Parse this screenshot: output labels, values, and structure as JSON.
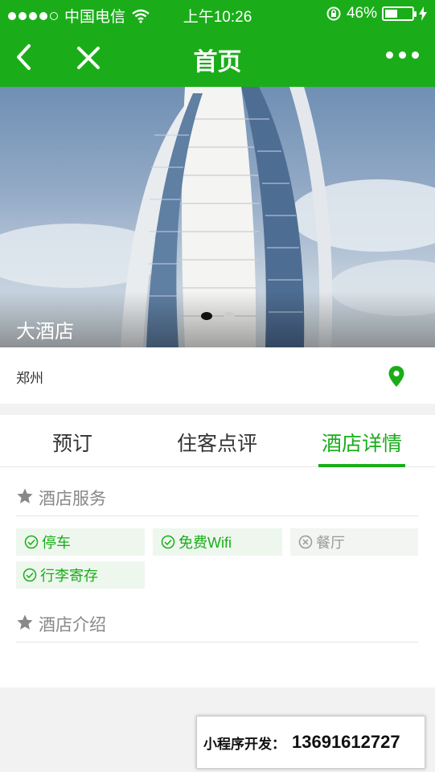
{
  "status_bar": {
    "carrier": "中国电信",
    "time": "上午10:26",
    "battery_percent": "46%",
    "battery_level": 0.46
  },
  "nav": {
    "title": "首页",
    "back_icon": "chevron-left-icon",
    "close_icon": "close-icon",
    "more_icon": "more-icon"
  },
  "banner": {
    "title": "大酒店",
    "slide_count": 2,
    "active_slide": 1
  },
  "location": {
    "city": "郑州",
    "icon": "location-pin-icon"
  },
  "tabs": [
    {
      "label": "预订",
      "active": false
    },
    {
      "label": "住客点评",
      "active": false
    },
    {
      "label": "酒店详情",
      "active": true
    }
  ],
  "services_section": {
    "title": "酒店服务",
    "items": [
      {
        "label": "停车",
        "available": true
      },
      {
        "label": "免费Wifi",
        "available": true
      },
      {
        "label": "餐厅",
        "available": false
      },
      {
        "label": "行李寄存",
        "available": true
      }
    ]
  },
  "intro_section": {
    "title": "酒店介绍"
  },
  "contact_banner": {
    "label": "小程序开发：",
    "phone": "13691612727"
  },
  "colors": {
    "brand_green": "#1aad19",
    "chip_bg": "#eef7ee"
  }
}
